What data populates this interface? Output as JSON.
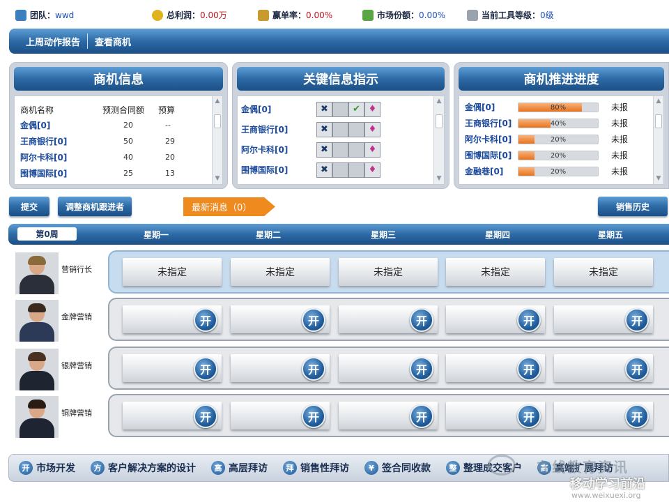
{
  "status": {
    "team_label": "团队：",
    "team_value": "wwd",
    "profit_label": "总利润：",
    "profit_value": "0.00万",
    "win_label": "赢单率：",
    "win_value": "0.00%",
    "share_label": "市场份额：",
    "share_value": "0.00%",
    "tool_label": "当前工具等级：",
    "tool_value": "0级"
  },
  "nav": {
    "items": [
      "上周动作报告",
      "查看商机"
    ]
  },
  "opportunity": {
    "title": "商机信息",
    "headers": [
      "商机名称",
      "预测合同额",
      "预算"
    ],
    "rows": [
      {
        "name": "金偶[0]",
        "forecast": "20",
        "budget": "--"
      },
      {
        "name": "王商银行[0]",
        "forecast": "50",
        "budget": "29"
      },
      {
        "name": "阿尔卡科[0]",
        "forecast": "40",
        "budget": "20"
      },
      {
        "name": "围博国际[0]",
        "forecast": "25",
        "budget": "13"
      }
    ]
  },
  "key_info": {
    "title": "关键信息指示",
    "rows": [
      {
        "name": "金偶[0]"
      },
      {
        "name": "王商银行[0]"
      },
      {
        "name": "阿尔卡科[0]"
      },
      {
        "name": "围博国际[0]"
      }
    ]
  },
  "progress": {
    "title": "商机推进进度",
    "rows": [
      {
        "name": "金偶[0]",
        "percent": 80,
        "label": "80%",
        "status": "未报"
      },
      {
        "name": "王商银行[0]",
        "percent": 40,
        "label": "40%",
        "status": "未报"
      },
      {
        "name": "阿尔卡科[0]",
        "percent": 20,
        "label": "20%",
        "status": "未报"
      },
      {
        "name": "围博国际[0]",
        "percent": 20,
        "label": "20%",
        "status": "未报"
      },
      {
        "name": "金融巷[0]",
        "percent": 20,
        "label": "20%",
        "status": "未报"
      }
    ]
  },
  "actions": {
    "submit": "提交",
    "adjust": "调整商机跟进者",
    "news": "最新消息（0）",
    "history": "销售历史"
  },
  "week": {
    "current": "第0周",
    "days": [
      "星期一",
      "星期二",
      "星期三",
      "星期四",
      "星期五"
    ]
  },
  "roster": [
    {
      "role": "营销行长",
      "slot_label": "未指定"
    },
    {
      "role": "金牌营销",
      "slot_label": "开"
    },
    {
      "role": "银牌营销",
      "slot_label": "开"
    },
    {
      "role": "铜牌营销",
      "slot_label": "开"
    }
  ],
  "legend": [
    {
      "glyph": "开",
      "label": "市场开发"
    },
    {
      "glyph": "方",
      "label": "客户解决方案的设计"
    },
    {
      "glyph": "高",
      "label": "高层拜访"
    },
    {
      "glyph": "拜",
      "label": "销售性拜访"
    },
    {
      "glyph": "¥",
      "label": "签合同收款"
    },
    {
      "glyph": "整",
      "label": "整理成交客户"
    },
    {
      "glyph": "高",
      "label": "高端扩展拜访"
    }
  ],
  "watermark": {
    "line1": "在线教育资讯",
    "line2": "移动学习前沿",
    "line3": "www.weixuexi.org"
  },
  "colors": {
    "accent": "#2d6aa6",
    "orange": "#ef8a1e",
    "value_red": "#c0141c"
  }
}
